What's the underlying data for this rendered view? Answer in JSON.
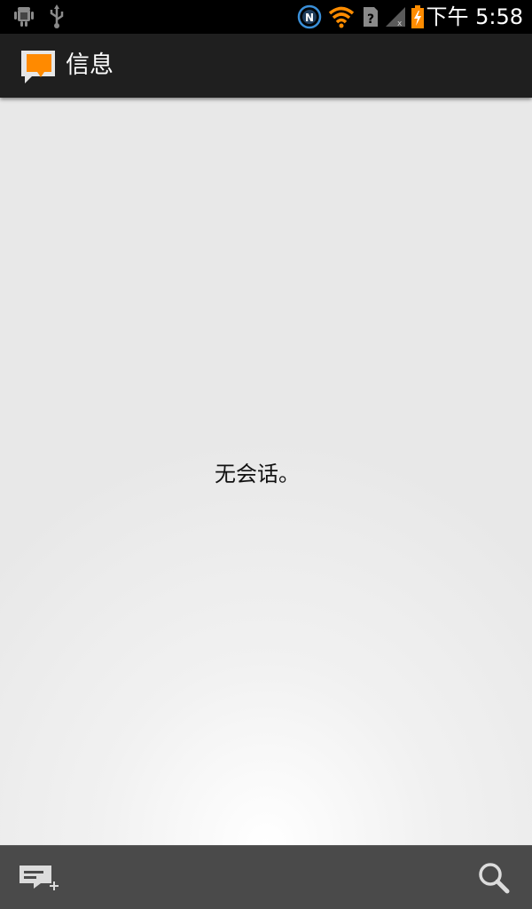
{
  "status_bar": {
    "time": "下午 5:58",
    "icons": [
      "android-debug-icon",
      "usb-icon",
      "nfc-icon",
      "wifi-icon",
      "sim-unknown-icon",
      "signal-icon",
      "battery-charging-icon"
    ],
    "colors": {
      "background": "#000000",
      "accent": "#ff8c00",
      "nfc": "#3a8fd8"
    }
  },
  "action_bar": {
    "title": "信息",
    "icon": "messaging-app-icon",
    "colors": {
      "background": "#1f1f1f",
      "icon_bubble": "#ff8a00"
    }
  },
  "content": {
    "empty_message": "无会话。"
  },
  "bottom_bar": {
    "compose_icon": "compose-new-message-icon",
    "search_icon": "search-icon",
    "colors": {
      "background": "#4a4a4a",
      "icon": "#dcdcdc"
    }
  }
}
